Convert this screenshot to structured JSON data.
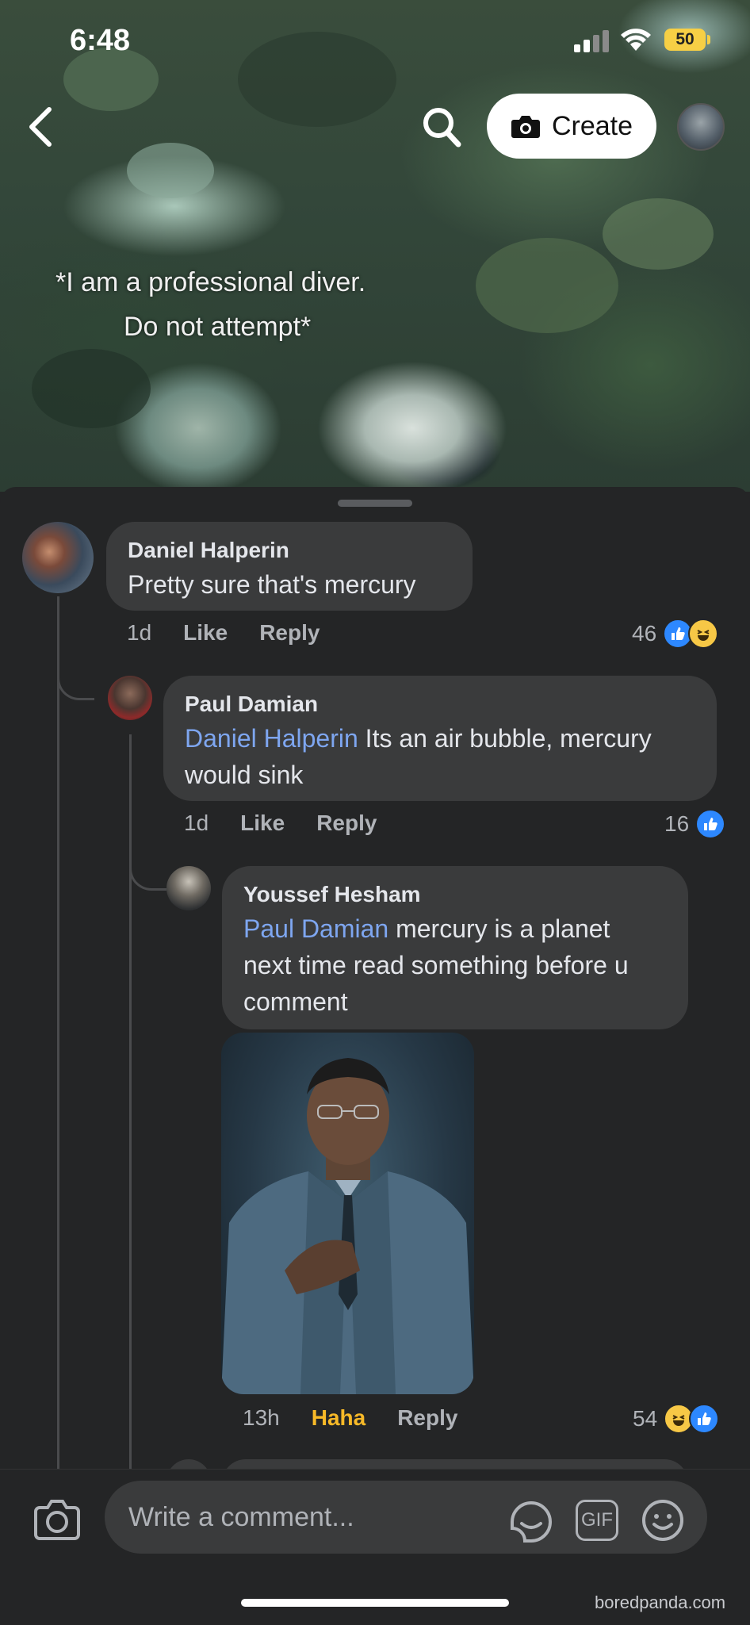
{
  "status_bar": {
    "time": "6:48",
    "battery": "50"
  },
  "header": {
    "create_label": "Create"
  },
  "video": {
    "caption_line1": "*I am a professional diver.",
    "caption_line2": "Do not attempt*"
  },
  "comments": [
    {
      "author": "Daniel Halperin",
      "text": "Pretty sure that's mercury",
      "time": "1d",
      "like_label": "Like",
      "reply_label": "Reply",
      "reaction_count": "46",
      "reactions": [
        "like-icon",
        "haha-icon"
      ]
    },
    {
      "author": "Paul Damian",
      "mention": "Daniel Halperin",
      "text_line1": " Its an air bubble, mercury",
      "text_line2": "would sink",
      "time": "1d",
      "like_label": "Like",
      "reply_label": "Reply",
      "reaction_count": "16",
      "reactions": [
        "like-icon"
      ]
    },
    {
      "author": "Youssef Hesham",
      "mention": "Paul Damian",
      "text_line1": " mercury is a planet",
      "text_line2": "next time read something before u",
      "text_line3": "comment",
      "time": "13h",
      "like_label": "Haha",
      "reply_label": "Reply",
      "reaction_count": "54",
      "reactions": [
        "haha-icon",
        "like-icon"
      ]
    }
  ],
  "composer": {
    "placeholder": "Write a comment...",
    "gif_label": "GIF"
  },
  "watermark": "boredpanda.com",
  "colors": {
    "sheet_bg": "#242526",
    "bubble_bg": "#3a3b3c",
    "mention": "#7ea6f0",
    "like_blue": "#2d88ff",
    "haha_yellow": "#f7b928"
  }
}
